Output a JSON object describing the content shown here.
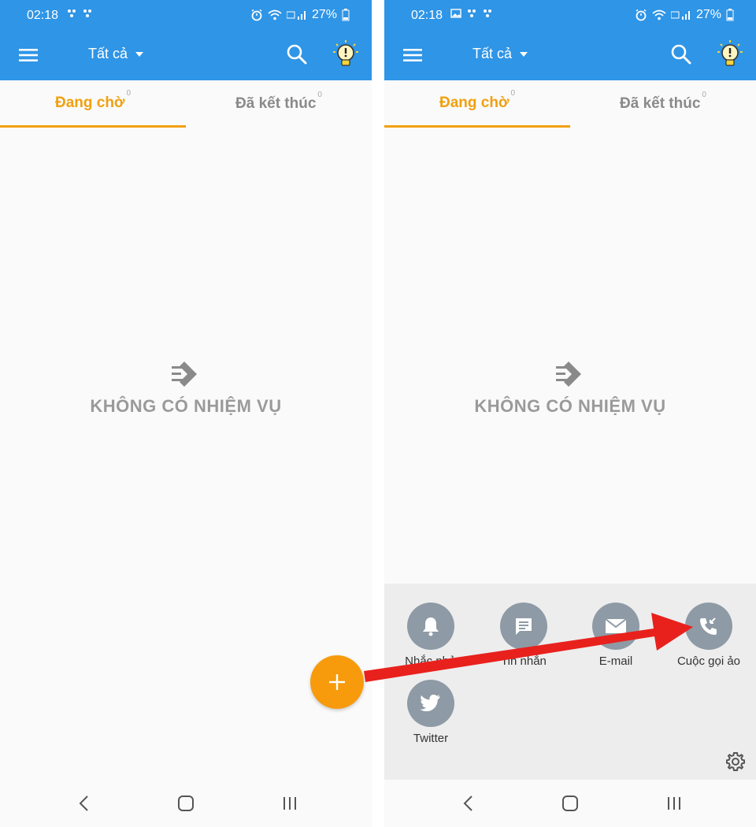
{
  "status": {
    "time": "02:18",
    "battery": "27%"
  },
  "appbar": {
    "filter_label": "Tất cả"
  },
  "tabs": [
    {
      "label": "Đang chờ",
      "count": "0"
    },
    {
      "label": "Đã kết thúc",
      "count": "0"
    }
  ],
  "empty": {
    "message": "KHÔNG CÓ NHIỆM VỤ"
  },
  "actions": [
    {
      "label": "Nhắc nhở",
      "icon": "bell-icon"
    },
    {
      "label": "Tin nhắn",
      "icon": "message-icon"
    },
    {
      "label": "E-mail",
      "icon": "email-icon"
    },
    {
      "label": "Cuộc gọi ảo",
      "icon": "phone-call-icon"
    },
    {
      "label": "Twitter",
      "icon": "twitter-icon"
    }
  ],
  "colors": {
    "primary": "#2f95e6",
    "accent": "#f1a00f",
    "fab": "#f79b0d",
    "annotation_arrow": "#e8211d"
  }
}
